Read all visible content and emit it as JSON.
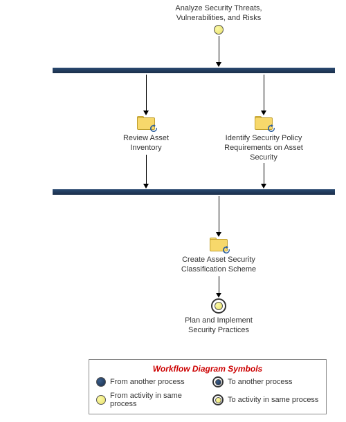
{
  "diagram": {
    "start_label": "Analyze Security Threats,\nVulnerabilities, and Risks",
    "activity_left": "Review Asset\nInventory",
    "activity_right": "Identify Security Policy\nRequirements on Asset\nSecurity",
    "activity_merge": "Create Asset Security\nClassification Scheme",
    "end_label": "Plan and Implement\nSecurity Practices"
  },
  "legend": {
    "title": "Workflow Diagram Symbols",
    "items": [
      {
        "kind": "navy-solid",
        "text": "From another process"
      },
      {
        "kind": "navy-ring",
        "text": "To another process"
      },
      {
        "kind": "yellow-solid",
        "text": "From activity in same process"
      },
      {
        "kind": "yellow-ring",
        "text": "To activity in same process"
      }
    ]
  }
}
